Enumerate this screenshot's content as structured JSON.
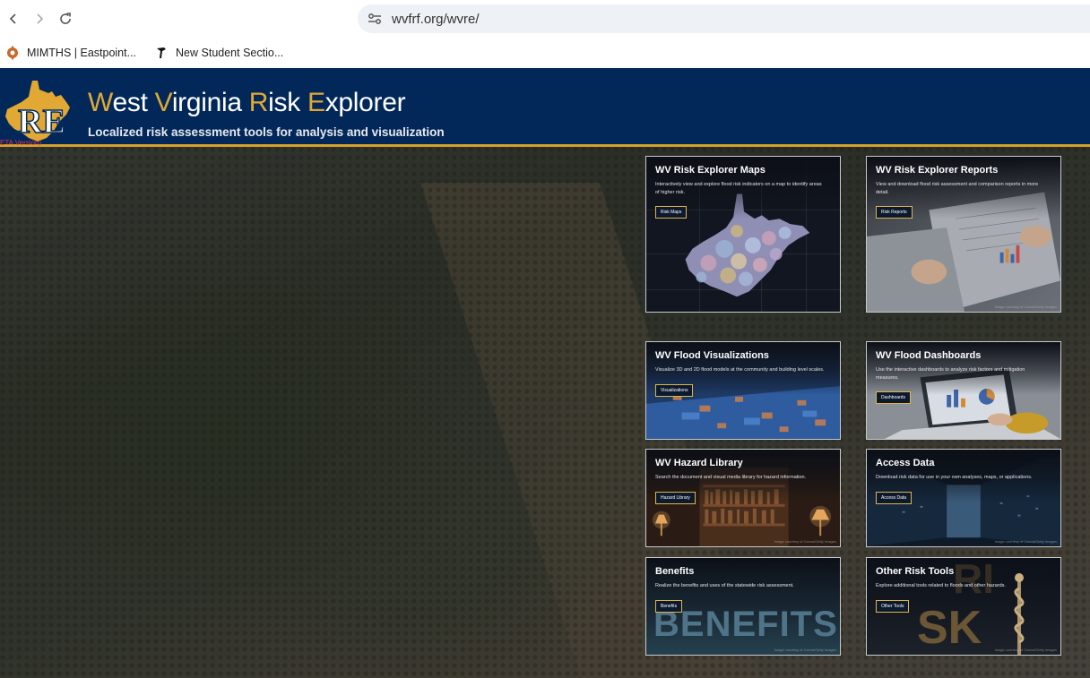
{
  "browser": {
    "url": "wvfrf.org/wvre/",
    "bookmarks": [
      {
        "label": "MIMTHS | Eastpoint..."
      },
      {
        "label": "New Student Sectio..."
      }
    ]
  },
  "header": {
    "logo_text": "RE",
    "beta_label": "ETA Version)",
    "title_words": [
      {
        "cap": "W",
        "rest": "est "
      },
      {
        "cap": "V",
        "rest": "irginia "
      },
      {
        "cap": "R",
        "rest": "isk "
      },
      {
        "cap": "E",
        "rest": "xplorer"
      }
    ],
    "subtitle": "Localized risk assessment tools for analysis and visualization"
  },
  "cards": {
    "maps": {
      "title": "WV Risk Explorer Maps",
      "desc": "Interactively view and explore flood risk indicators on a map to identify areas of higher risk.",
      "button": "Risk Maps"
    },
    "reports": {
      "title": "WV Risk Explorer Reports",
      "desc": "View and download flood risk assessment and comparison reports in more detail.",
      "button": "Risk Reports",
      "credit": "Image courtesy of Canva/Getty Images"
    },
    "visualizations": {
      "title": "WV Flood Visualizations",
      "desc": "Visualize 3D and 2D flood models at the community and building level scales.",
      "button": "Visualizations"
    },
    "dashboards": {
      "title": "WV Flood Dashboards",
      "desc": "Use the interactive dashboards to analyze risk factors and mitigation measures.",
      "button": "Dashboards"
    },
    "library": {
      "title": "WV Hazard Library",
      "desc": "Search the document and visual media library for hazard information.",
      "button": "Hazard Library",
      "credit": "Image courtesy of Canva/Getty Images"
    },
    "data": {
      "title": "Access Data",
      "desc": "Download risk data for use in your own analyses, maps, or applications.",
      "button": "Access Data",
      "credit": "Image courtesy of Canva/Getty Images"
    },
    "benefits": {
      "title": "Benefits",
      "desc": "Realize the benefits and uses of the statewide risk assessment.",
      "button": "Benefits",
      "image_text": "BENEFITS",
      "credit": "Image courtesy of Canva/Getty Images"
    },
    "other": {
      "title": "Other Risk Tools",
      "desc": "Explore additional tools related to floods and other hazards.",
      "button": "Other Tools",
      "image_text_top": "RI",
      "image_text_bottom": "SK",
      "credit": "Image courtesy of Canva/Getty Images"
    }
  },
  "colors": {
    "header_bg": "#02285a",
    "accent_gold": "#e1a934",
    "beta_red": "#e0334c"
  }
}
